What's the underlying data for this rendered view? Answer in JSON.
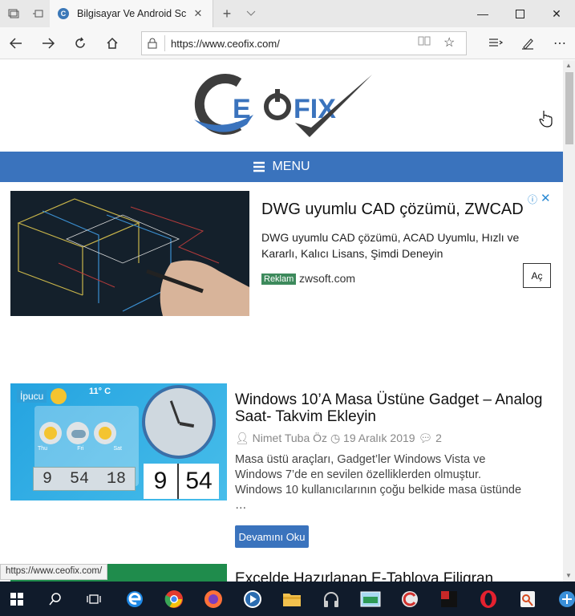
{
  "browser": {
    "tab_title": "Bilgisayar Ve Android Sc",
    "favicon_letter": "C",
    "url": "https://www.ceofix.com/"
  },
  "site": {
    "logo_text": "CEOFIX",
    "menu_label": "MENU"
  },
  "ad": {
    "headline": "DWG uyumlu CAD çözümü, ZWCAD",
    "description": "DWG uyumlu CAD çözümü, ACAD Uyumlu, Hızlı ve Kararlı, Kalıcı Lisans, Şimdi Deneyin",
    "badge": "Reklam",
    "domain": "zwsoft.com",
    "button": "Aç"
  },
  "post": {
    "category": "İpucu",
    "title": "Windows 10’A Masa Üstüne Gadget – Analog Saat- Takvim Ekleyin",
    "author": "Nimet Tuba Öz",
    "date": "19 Aralık 2019",
    "comments": "2",
    "excerpt": "Masa üstü araçları, Gadget’ler Windows Vista ve Windows 7’de en sevilen özelliklerden olmuştur. Windows 10 kullanıcılarının çoğu belkide masa üstünde …",
    "read_more": "Devamını Oku",
    "thumb_temp": "11° C",
    "thumb_time": [
      "9",
      "54",
      "18"
    ],
    "thumb_big_time": [
      "9",
      "54"
    ],
    "thumb_days": [
      "Thu",
      "Fri",
      "Sat"
    ]
  },
  "post2": {
    "title": "Excelde Hazırlanan E-Tabloya Filigran"
  },
  "status_bar": "https://www.ceofix.com/",
  "colors": {
    "accent": "#3a73bd",
    "taskbar": "#101b2b"
  }
}
